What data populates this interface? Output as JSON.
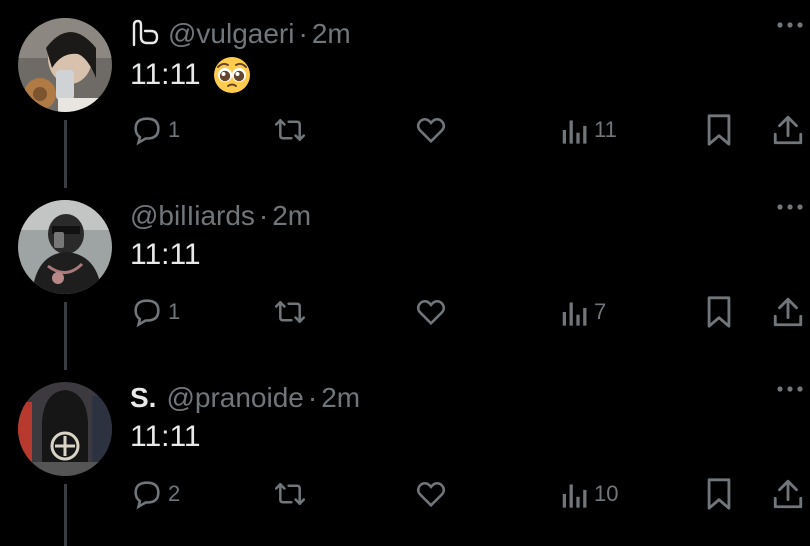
{
  "colors": {
    "background": "#000000",
    "text": "#e7e9ea",
    "muted": "#71767b",
    "thread_line": "#3a3d41"
  },
  "tweets": [
    {
      "display_name": "",
      "name_icon": "rope-loop-icon",
      "handle": "@vulgaeri",
      "separator": "·",
      "time": "2m",
      "text": "11:11",
      "emoji": "pleading-face-emoji",
      "replies": "1",
      "views": "11"
    },
    {
      "display_name": "",
      "handle": "@bilIiards",
      "separator": "·",
      "time": "2m",
      "text": "11:11",
      "replies": "1",
      "views": "7"
    },
    {
      "display_name": "S.",
      "handle": "@pranoide",
      "separator": "·",
      "time": "2m",
      "text": "11:11",
      "replies": "2",
      "views": "10"
    }
  ]
}
